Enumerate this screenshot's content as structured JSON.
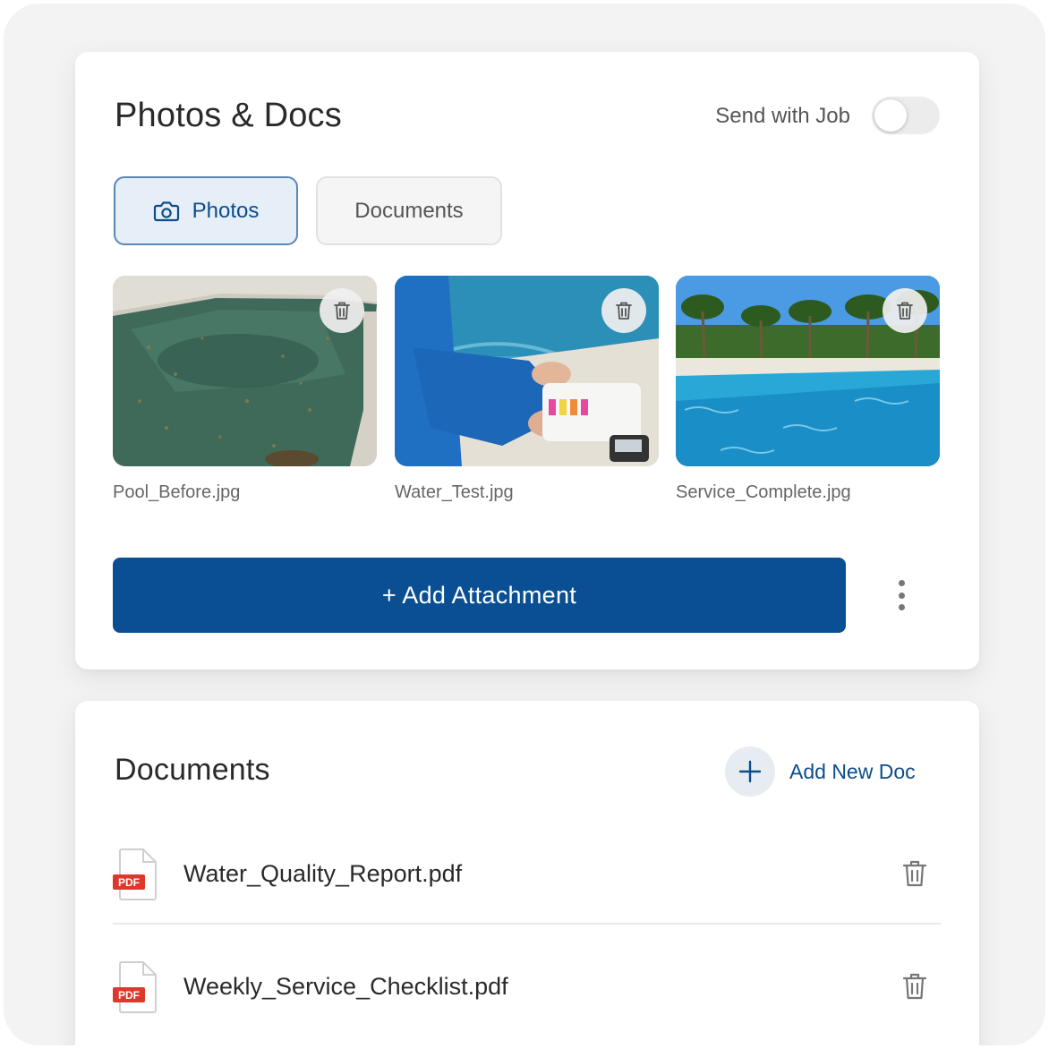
{
  "photos_card": {
    "title": "Photos & Docs",
    "send_with_job_label": "Send with Job",
    "send_with_job_enabled": false,
    "tabs": [
      {
        "label": "Photos",
        "icon": "camera-icon",
        "active": true
      },
      {
        "label": "Documents",
        "active": false
      }
    ],
    "photos": [
      {
        "filename": "Pool_Before.jpg",
        "scene": "dirty green pool with leaves"
      },
      {
        "filename": "Water_Test.jpg",
        "scene": "technician with water test kit"
      },
      {
        "filename": "Service_Complete.jpg",
        "scene": "clean blue pool with palm trees"
      }
    ],
    "add_attachment_label": "+ Add Attachment",
    "more_icon": "vertical-ellipsis-icon"
  },
  "documents_card": {
    "title": "Documents",
    "add_new_doc_label": "Add New Doc",
    "file_badge": "PDF",
    "documents": [
      {
        "name": "Water_Quality_Report.pdf"
      },
      {
        "name": "Weekly_Service_Checklist.pdf"
      }
    ]
  },
  "colors": {
    "primary": "#0a4f94",
    "active_tab_bg": "#e6eef7",
    "pdf_badge": "#e0372c"
  }
}
